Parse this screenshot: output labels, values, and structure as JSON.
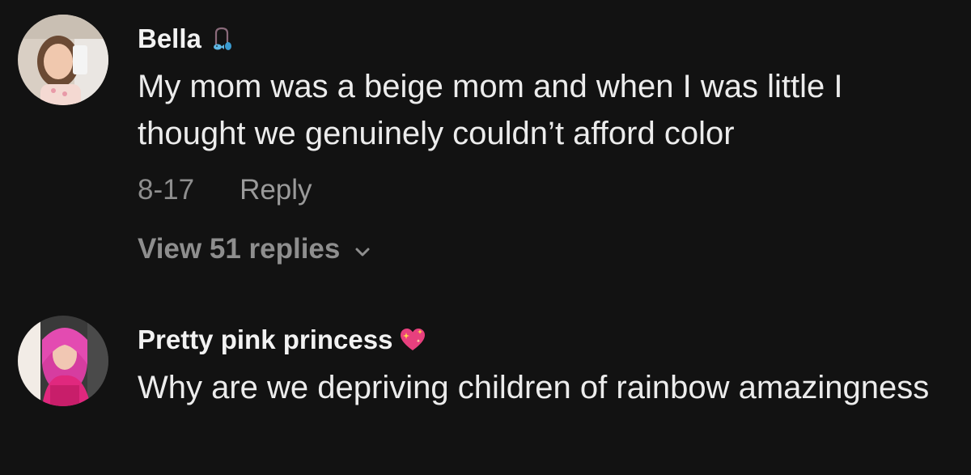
{
  "comments": [
    {
      "username": "Bella",
      "username_emoji": "fishing-pole-fish-icon",
      "text": "My mom was a beige mom and when I was little I thought we genuinely couldn’t afford color",
      "date": "8-17",
      "reply_label": "Reply",
      "view_replies_label": "View 51 replies",
      "avatar": "user-avatar-photo"
    },
    {
      "username": "Pretty pink princess",
      "username_emoji": "sparkling-heart-icon",
      "text": "Why are we depriving children of rainbow amazingness",
      "avatar": "user-avatar-photo"
    }
  ],
  "colors": {
    "background": "#121212",
    "text": "#ececec",
    "muted": "#8e8e8e"
  }
}
